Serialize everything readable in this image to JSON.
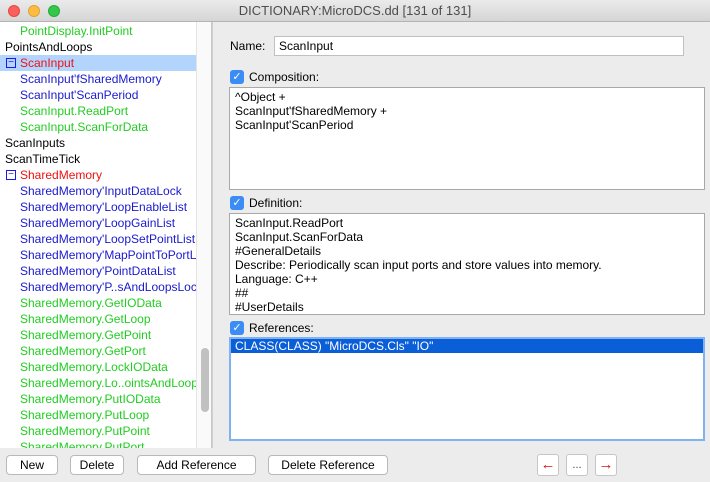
{
  "window": {
    "title": "DICTIONARY:MicroDCS.dd [131 of 131]"
  },
  "tree": {
    "expander_symbol": "−",
    "items": [
      {
        "label": "PointDisplay.InitPoint",
        "color": "green",
        "indent": 1
      },
      {
        "label": "PointsAndLoops",
        "color": "black",
        "indent": 0
      },
      {
        "label": "ScanInput",
        "color": "red",
        "indent": 0,
        "expander": true,
        "selected": true
      },
      {
        "label": "ScanInput'fSharedMemory",
        "color": "blue",
        "indent": 1
      },
      {
        "label": "ScanInput'ScanPeriod",
        "color": "blue",
        "indent": 1
      },
      {
        "label": "ScanInput.ReadPort",
        "color": "green",
        "indent": 1
      },
      {
        "label": "ScanInput.ScanForData",
        "color": "green",
        "indent": 1
      },
      {
        "label": "ScanInputs",
        "color": "black",
        "indent": 0
      },
      {
        "label": "ScanTimeTick",
        "color": "black",
        "indent": 0
      },
      {
        "label": "SharedMemory",
        "color": "red",
        "indent": 0,
        "expander": true
      },
      {
        "label": "SharedMemory'InputDataLock",
        "color": "blue",
        "indent": 1
      },
      {
        "label": "SharedMemory'LoopEnableList",
        "color": "blue",
        "indent": 1
      },
      {
        "label": "SharedMemory'LoopGainList",
        "color": "blue",
        "indent": 1
      },
      {
        "label": "SharedMemory'LoopSetPointList",
        "color": "blue",
        "indent": 1
      },
      {
        "label": "SharedMemory'MapPointToPortL",
        "color": "blue",
        "indent": 1
      },
      {
        "label": "SharedMemory'PointDataList",
        "color": "blue",
        "indent": 1
      },
      {
        "label": "SharedMemory'P..sAndLoopsLoc",
        "color": "blue",
        "indent": 1
      },
      {
        "label": "SharedMemory.GetIOData",
        "color": "green",
        "indent": 1
      },
      {
        "label": "SharedMemory.GetLoop",
        "color": "green",
        "indent": 1
      },
      {
        "label": "SharedMemory.GetPoint",
        "color": "green",
        "indent": 1
      },
      {
        "label": "SharedMemory.GetPort",
        "color": "green",
        "indent": 1
      },
      {
        "label": "SharedMemory.LockIOData",
        "color": "green",
        "indent": 1
      },
      {
        "label": "SharedMemory.Lo..ointsAndLoop",
        "color": "green",
        "indent": 1
      },
      {
        "label": "SharedMemory.PutIOData",
        "color": "green",
        "indent": 1
      },
      {
        "label": "SharedMemory.PutLoop",
        "color": "green",
        "indent": 1
      },
      {
        "label": "SharedMemory.PutPoint",
        "color": "green",
        "indent": 1
      },
      {
        "label": "SharedMemory.PutPort",
        "color": "green",
        "indent": 1
      }
    ]
  },
  "detail": {
    "name_label": "Name:",
    "name_value": "ScanInput",
    "composition": {
      "label": "Composition:",
      "checked": true,
      "lines": [
        "^Object +",
        "ScanInput'fSharedMemory +",
        "ScanInput'ScanPeriod"
      ]
    },
    "definition": {
      "label": "Definition:",
      "checked": true,
      "lines": [
        "ScanInput.ReadPort",
        "ScanInput.ScanForData",
        "#GeneralDetails",
        "Describe: Periodically scan input ports and store values into memory.",
        "Language: C++",
        "##",
        "#UserDetails"
      ]
    },
    "references": {
      "label": "References:",
      "checked": true,
      "items": [
        "CLASS(CLASS) \"MicroDCS.Cls\" \"IO\""
      ]
    }
  },
  "buttons": {
    "new": "New",
    "delete": "Delete",
    "add_reference": "Add Reference",
    "delete_reference": "Delete Reference",
    "nav_prev": "←",
    "nav_more": "...",
    "nav_next": "→"
  },
  "checkmark": "✓"
}
